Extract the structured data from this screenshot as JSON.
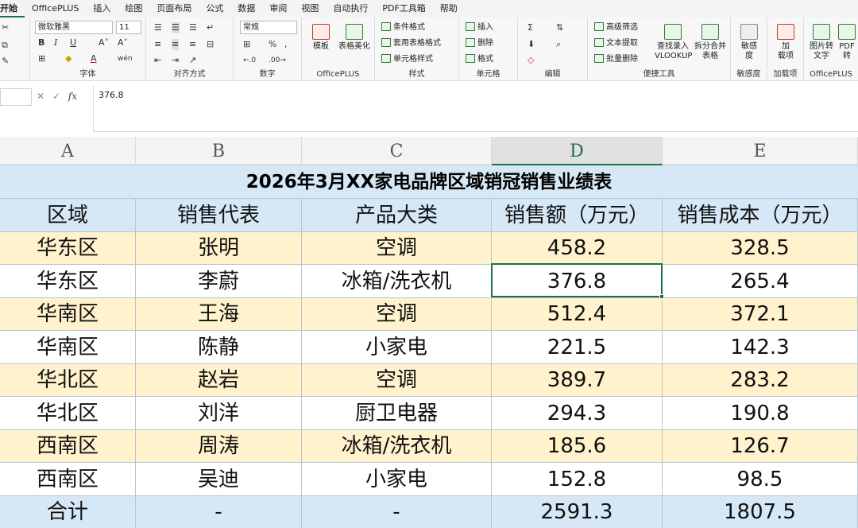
{
  "menu": [
    "开始",
    "OfficePLUS",
    "插入",
    "绘图",
    "页面布局",
    "公式",
    "数据",
    "审阅",
    "视图",
    "自动执行",
    "PDF工具箱",
    "帮助"
  ],
  "ribbon": {
    "font_name": "微软雅黑",
    "font_size": "11",
    "number_format": "常规",
    "group_labels": {
      "font": "字体",
      "align": "对齐方式",
      "number": "数字",
      "officeplus": "OfficePLUS",
      "styles": "样式",
      "cells": "单元格",
      "editing": "编辑",
      "tools": "便捷工具",
      "sensitivity": "敏感度",
      "addins": "加载项",
      "officeplus2": "OfficePLUS"
    },
    "officeplus": {
      "template": "模板",
      "beautify": "表格美化"
    },
    "styles": {
      "conditional": "条件格式",
      "table_format": "套用表格格式",
      "cell_style": "单元格样式"
    },
    "cells": {
      "insert": "插入",
      "delete": "删除",
      "format": "格式"
    },
    "tools": {
      "filter": "高级筛选",
      "extract": "文本提取",
      "batch_delete": "批量删除",
      "lookup1": "查找录入",
      "lookup2": "VLOOKUP",
      "split1": "拆分合并",
      "split2": "表格"
    },
    "sensitivity": {
      "l1": "敏感",
      "l2": "度"
    },
    "addins": {
      "l1": "加",
      "l2": "载项"
    },
    "right": {
      "img1": "图片转",
      "img2": "文字",
      "pdf": "PDF转"
    }
  },
  "formula_bar": {
    "name_box": "",
    "value": "376.8"
  },
  "columns": [
    "A",
    "B",
    "C",
    "D",
    "E"
  ],
  "sheet": {
    "title": "2026年3月XX家电品牌区域销冠销售业绩表",
    "headers": [
      "区域",
      "销售代表",
      "产品大类",
      "销售额（万元）",
      "销售成本（万元）"
    ],
    "rows": [
      [
        "华东区",
        "张明",
        "空调",
        "458.2",
        "328.5"
      ],
      [
        "华东区",
        "李蔚",
        "冰箱/洗衣机",
        "376.8",
        "265.4"
      ],
      [
        "华南区",
        "王海",
        "空调",
        "512.4",
        "372.1"
      ],
      [
        "华南区",
        "陈静",
        "小家电",
        "221.5",
        "142.3"
      ],
      [
        "华北区",
        "赵岩",
        "空调",
        "389.7",
        "283.2"
      ],
      [
        "华北区",
        "刘洋",
        "厨卫电器",
        "294.3",
        "190.8"
      ],
      [
        "西南区",
        "周涛",
        "冰箱/洗衣机",
        "185.6",
        "126.7"
      ],
      [
        "西南区",
        "吴迪",
        "小家电",
        "152.8",
        "98.5"
      ]
    ],
    "total": [
      "合计",
      "-",
      "-",
      "2591.3",
      "1807.5"
    ]
  },
  "colors": {
    "title_bg": "#d6e8f6",
    "header_bg": "#d6e8f6",
    "band_bg": "#fff2cc",
    "white": "#ffffff",
    "total_bg": "#d6e8f6",
    "accent": "#1e7145"
  }
}
